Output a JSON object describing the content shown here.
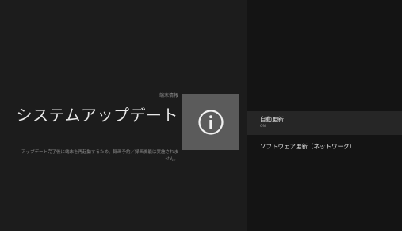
{
  "header": {
    "breadcrumb": "端末情報",
    "title": "システムアップデート",
    "description": "アップデート完了後に端末を再起動するため、録画予約／録画機能は実施されません。"
  },
  "info_tile": {
    "icon": "info-icon"
  },
  "menu": {
    "items": [
      {
        "label": "自動更新",
        "sublabel": "ON"
      },
      {
        "label": "ソフトウェア更新（ネットワーク）"
      }
    ]
  }
}
